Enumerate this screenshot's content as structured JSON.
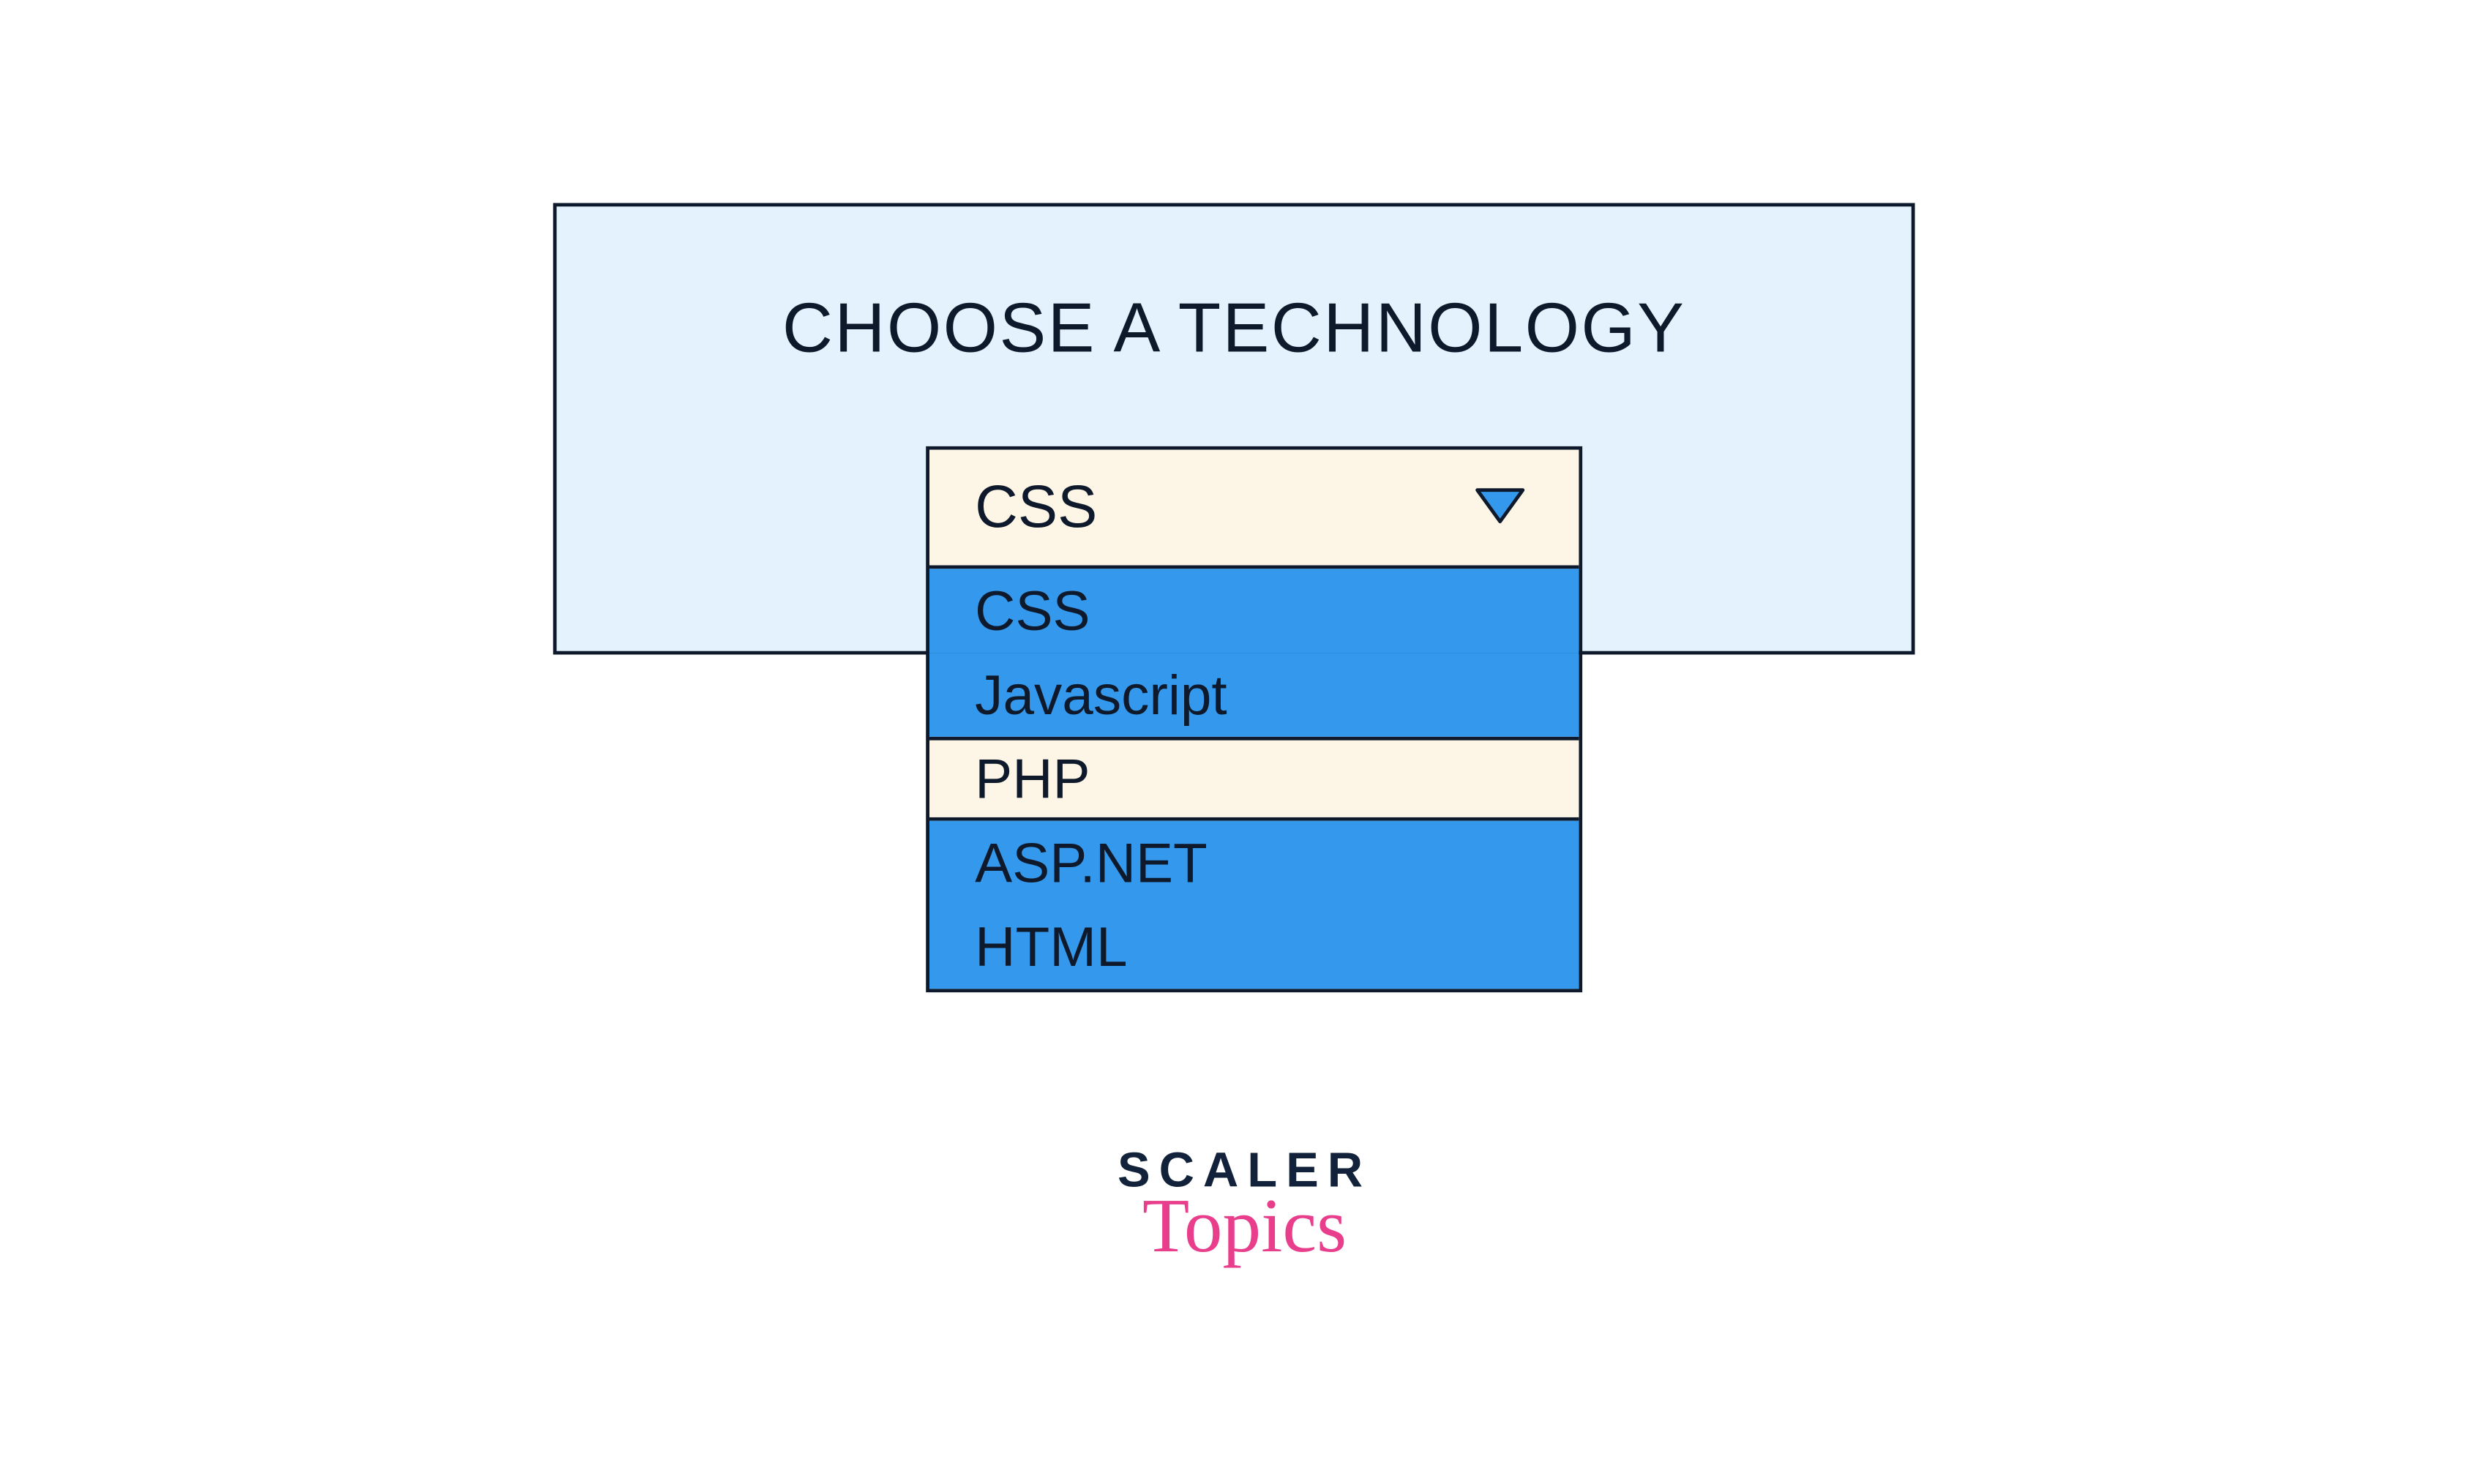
{
  "panel": {
    "title": "CHOOSE A TECHNOLOGY"
  },
  "dropdown": {
    "selected": "CSS",
    "hovered_index": 2,
    "options": [
      "CSS",
      "Javascript",
      "PHP",
      "ASP.NET",
      "HTML"
    ]
  },
  "brand": {
    "line1": "SCALER",
    "line2": "Topics"
  },
  "colors": {
    "panel_bg": "#e3f2fd",
    "border": "#0e1a2b",
    "option_bg": "#3498ec",
    "option_hover_bg": "#fdf5e6",
    "accent_pink": "#e83e8c"
  }
}
